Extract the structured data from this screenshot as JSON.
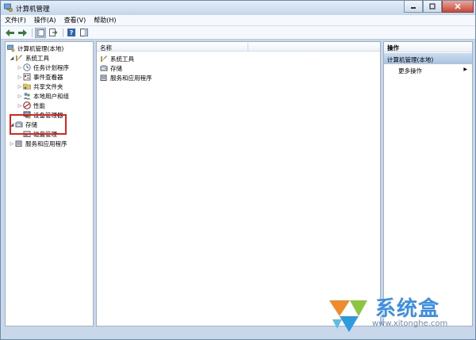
{
  "window": {
    "title": "计算机管理"
  },
  "menu": {
    "items": [
      "文件(F)",
      "操作(A)",
      "查看(V)",
      "帮助(H)"
    ]
  },
  "toolbar": {
    "buttons": [
      "back-icon",
      "forward-icon",
      "console-tree-icon",
      "export-list-icon",
      "help-icon",
      "show-hide-icon"
    ]
  },
  "tree": {
    "root": "计算机管理(本地)",
    "system_tools": "系统工具",
    "task_scheduler": "任务计划程序",
    "event_viewer": "事件查看器",
    "shared_folders": "共享文件夹",
    "local_users": "本地用户和组",
    "performance": "性能",
    "device_manager": "设备管理器",
    "storage": "存储",
    "disk_management": "磁盘管理",
    "services_apps": "服务和应用程序"
  },
  "center": {
    "column_name": "名称",
    "items": [
      "系统工具",
      "存储",
      "服务和应用程序"
    ]
  },
  "actions": {
    "title": "操作",
    "group": "计算机管理(本地)",
    "more": "更多操作"
  },
  "watermark": {
    "brand": "系统盒",
    "url": "www.xitonghe.com"
  },
  "colors": {
    "highlight_box": "#e0251f",
    "selected_group": "#b7cde6"
  }
}
